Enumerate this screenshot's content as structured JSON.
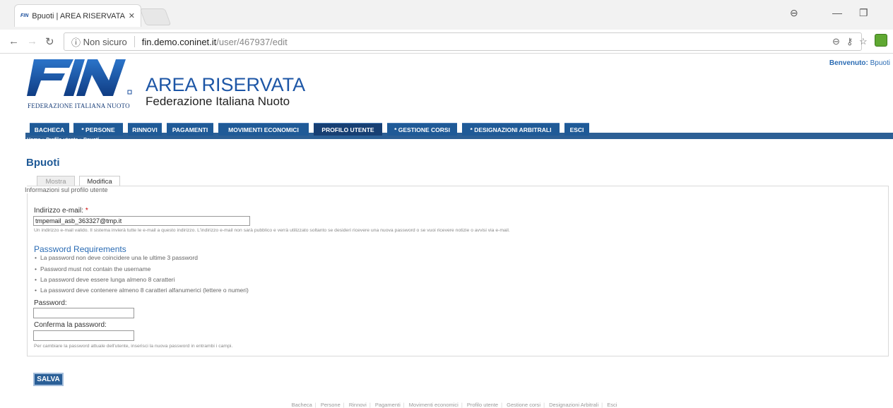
{
  "browser": {
    "tab_title": "Bpuoti | AREA RISERVATA",
    "tab_favicon": "FIN",
    "address_security": "Non sicuro",
    "address_host": "fin.demo.coninet.it",
    "address_path": "/user/467937/edit"
  },
  "header": {
    "logo_text": "FIN",
    "logo_subtitle": "FEDERAZIONE ITALIANA NUOTO",
    "title": "AREA RISERVATA",
    "subtitle": "Federazione Italiana Nuoto",
    "welcome_label": "Benvenuto:",
    "welcome_user": "Bpuoti"
  },
  "menu": {
    "items": [
      {
        "label": "BACHECA"
      },
      {
        "label": "* PERSONE"
      },
      {
        "label": "RINNOVI"
      },
      {
        "label": "PAGAMENTI"
      },
      {
        "label": "MOVIMENTI ECONOMICI"
      },
      {
        "label": "PROFILO UTENTE"
      },
      {
        "label": "* GESTIONE CORSI"
      },
      {
        "label": "* DESIGNAZIONI ARBITRALI"
      },
      {
        "label": "ESCI"
      }
    ],
    "breadcrumb": "Home » Profilo utente » Bpuoti"
  },
  "main": {
    "user_title": "Bpuoti",
    "tabs": [
      {
        "label": "Mostra"
      },
      {
        "label": "Modifica"
      }
    ],
    "fieldset_legend": "Informazioni sul profilo utente",
    "email_label": "Indirizzo e-mail:",
    "email_required": "*",
    "email_value": "tmpemail_asb_363327@tmp.it",
    "email_desc": "Un indirizzo e-mail valido. Il sistema invierà tutte le e-mail a questo indirizzo. L'indirizzo e-mail non sarà pubblico e verrà utilizzato soltanto se desideri ricevere una nuova password o se vuoi ricevere notizie o avvisi via e-mail.",
    "pw_req_title": "Password Requirements",
    "pw_req_items": [
      "La password non deve coincidere una le ultime 3 password",
      "Password must not contain the username",
      "La password deve essere lunga almeno 8 caratteri",
      "La password deve contenere almeno 8 caratteri alfanumerici (lettere o numeri)"
    ],
    "password_label": "Password:",
    "confirm_label": "Conferma la password:",
    "pw_desc": "Per cambiare la password attuale dell'utente, inserisci la nuova password in entrambi i campi.",
    "save_label": "SALVA"
  },
  "footer": {
    "links": [
      "Bacheca",
      "Persone",
      "Rinnovi",
      "Pagamenti",
      "Movimenti economici",
      "Profilo utente",
      "Gestione corsi",
      "Designazioni Arbitrali",
      "Esci"
    ]
  },
  "colors": {
    "brand": "#1f5a97",
    "title_blue": "#1d56a6"
  }
}
